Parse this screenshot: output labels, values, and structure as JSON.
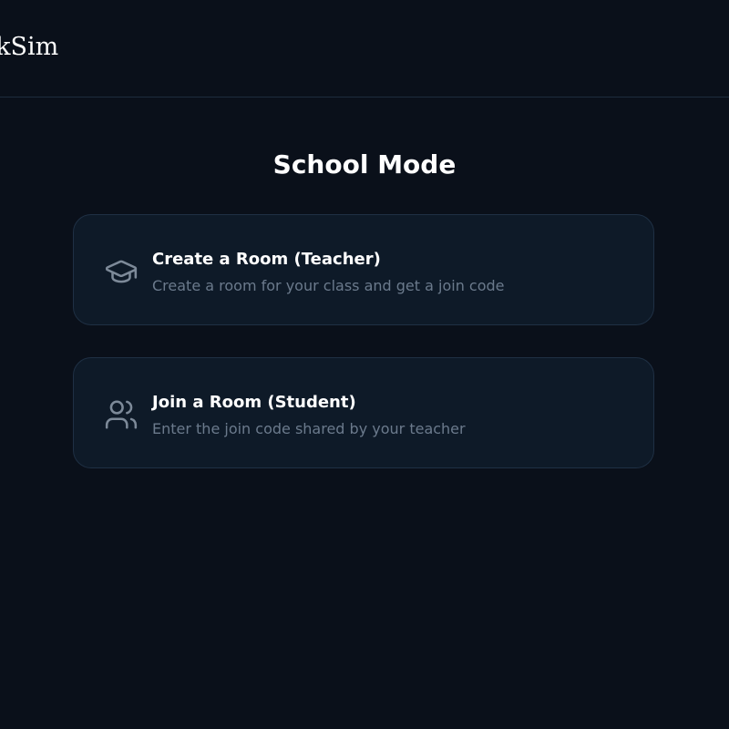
{
  "header": {
    "brand": "ckSim"
  },
  "main": {
    "title": "School Mode",
    "options": [
      {
        "title": "Create a Room (Teacher)",
        "description": "Create a room for your class and get a join code",
        "icon": "graduation-cap-icon"
      },
      {
        "title": "Join a Room (Student)",
        "description": "Enter the join code shared by your teacher",
        "icon": "users-icon"
      }
    ]
  },
  "colors": {
    "background": "#0a101a",
    "card_background": "#0e1a28",
    "card_border": "#1f3044",
    "text_primary": "#ffffff",
    "text_secondary": "#6b7a8c",
    "icon": "#7d8a99"
  }
}
